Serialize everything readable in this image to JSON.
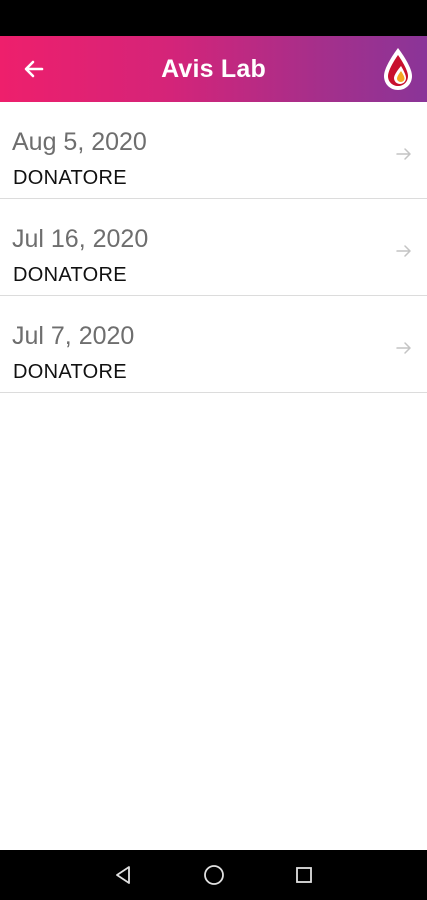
{
  "app_bar": {
    "title": "Avis Lab",
    "gradient": [
      "#ee1f6c",
      "#8a3598"
    ]
  },
  "icons": {
    "back": "arrow-left-icon",
    "logo": "blood-drop-logo",
    "row_arrow": "arrow-right-icon"
  },
  "donations": [
    {
      "date": "Aug 5, 2020",
      "role": "DONATORE"
    },
    {
      "date": "Jul 16, 2020",
      "role": "DONATORE"
    },
    {
      "date": "Jul 7, 2020",
      "role": "DONATORE"
    }
  ],
  "navigation": {
    "buttons": [
      "back-triangle-icon",
      "home-circle-icon",
      "recents-square-icon"
    ]
  }
}
